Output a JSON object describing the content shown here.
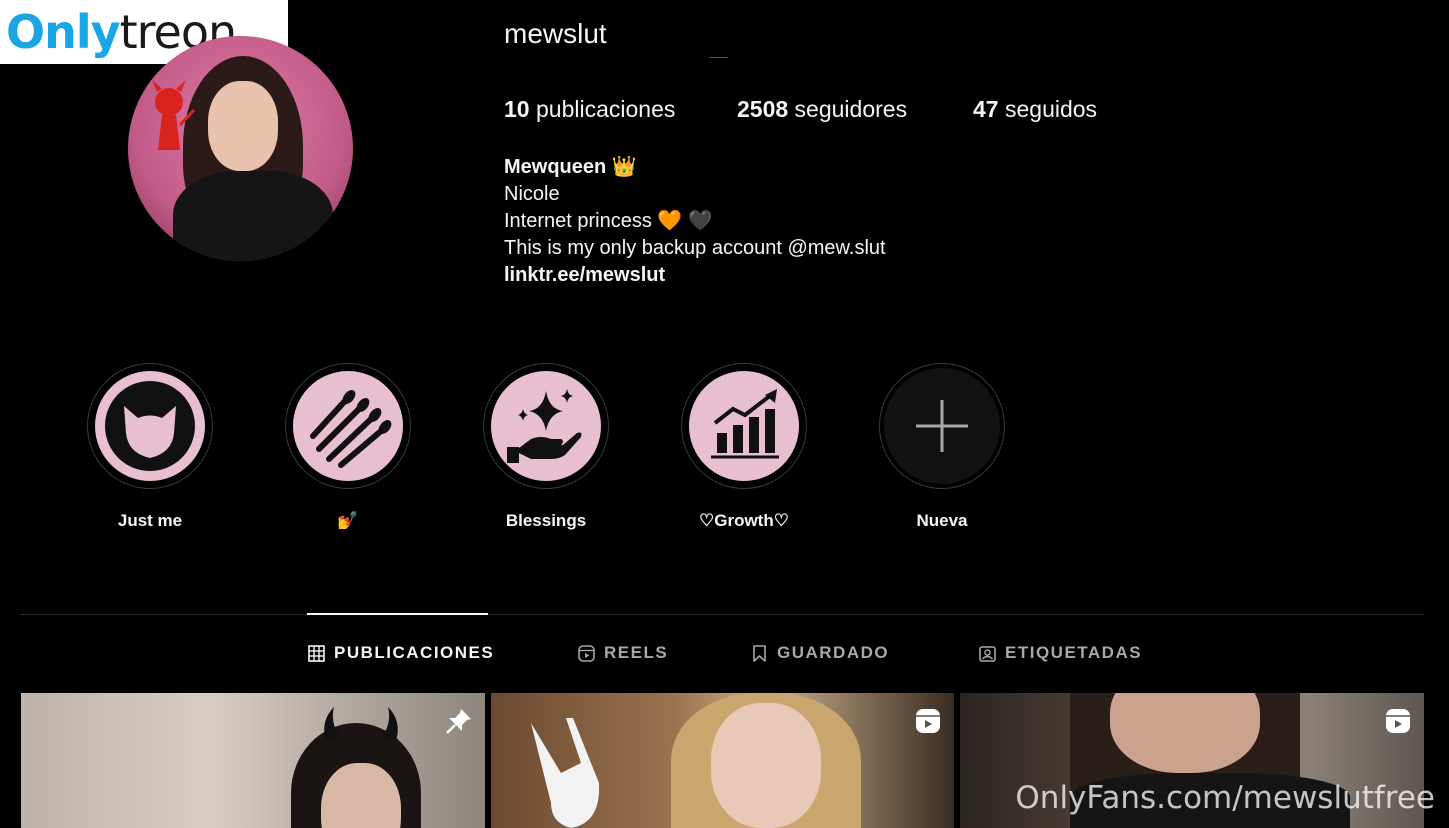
{
  "logo": {
    "part1": "Only",
    "part2": "treon"
  },
  "profile": {
    "username": "mewslut",
    "stats": {
      "posts_count": "10",
      "posts_label": " publicaciones",
      "followers_count": "2508",
      "followers_label": " seguidores",
      "following_count": "47",
      "following_label": " seguidos"
    },
    "bio": {
      "name": "Mewqueen 👑",
      "line1": "Nicole",
      "line2": "Internet princess 🧡 🖤",
      "line3": "This is my only backup account @mew.slut",
      "link": "linktr.ee/mewslut"
    }
  },
  "highlights": [
    {
      "label": "Just me",
      "icon": "cat-icon"
    },
    {
      "label": "💅",
      "icon": "nails-icon"
    },
    {
      "label": "Blessings",
      "icon": "sparkle-hand-icon"
    },
    {
      "label": "♡Growth♡",
      "icon": "growth-chart-icon"
    },
    {
      "label": "Nueva",
      "icon": "plus-icon"
    }
  ],
  "tabs": [
    {
      "label": "PUBLICACIONES",
      "icon": "grid-icon",
      "active": true
    },
    {
      "label": "REELS",
      "icon": "reels-icon",
      "active": false
    },
    {
      "label": "GUARDADO",
      "icon": "bookmark-icon",
      "active": false
    },
    {
      "label": "ETIQUETADAS",
      "icon": "tagged-icon",
      "active": false
    }
  ],
  "posts": [
    {
      "badge": "pin-icon"
    },
    {
      "badge": "reel-icon"
    },
    {
      "badge": "reel-icon"
    }
  ],
  "watermark": "OnlyFans.com/mewslutfree",
  "colors": {
    "background": "#000000",
    "highlight_fill": "#e8bfd0",
    "logo_blue": "#1aa5e4"
  }
}
